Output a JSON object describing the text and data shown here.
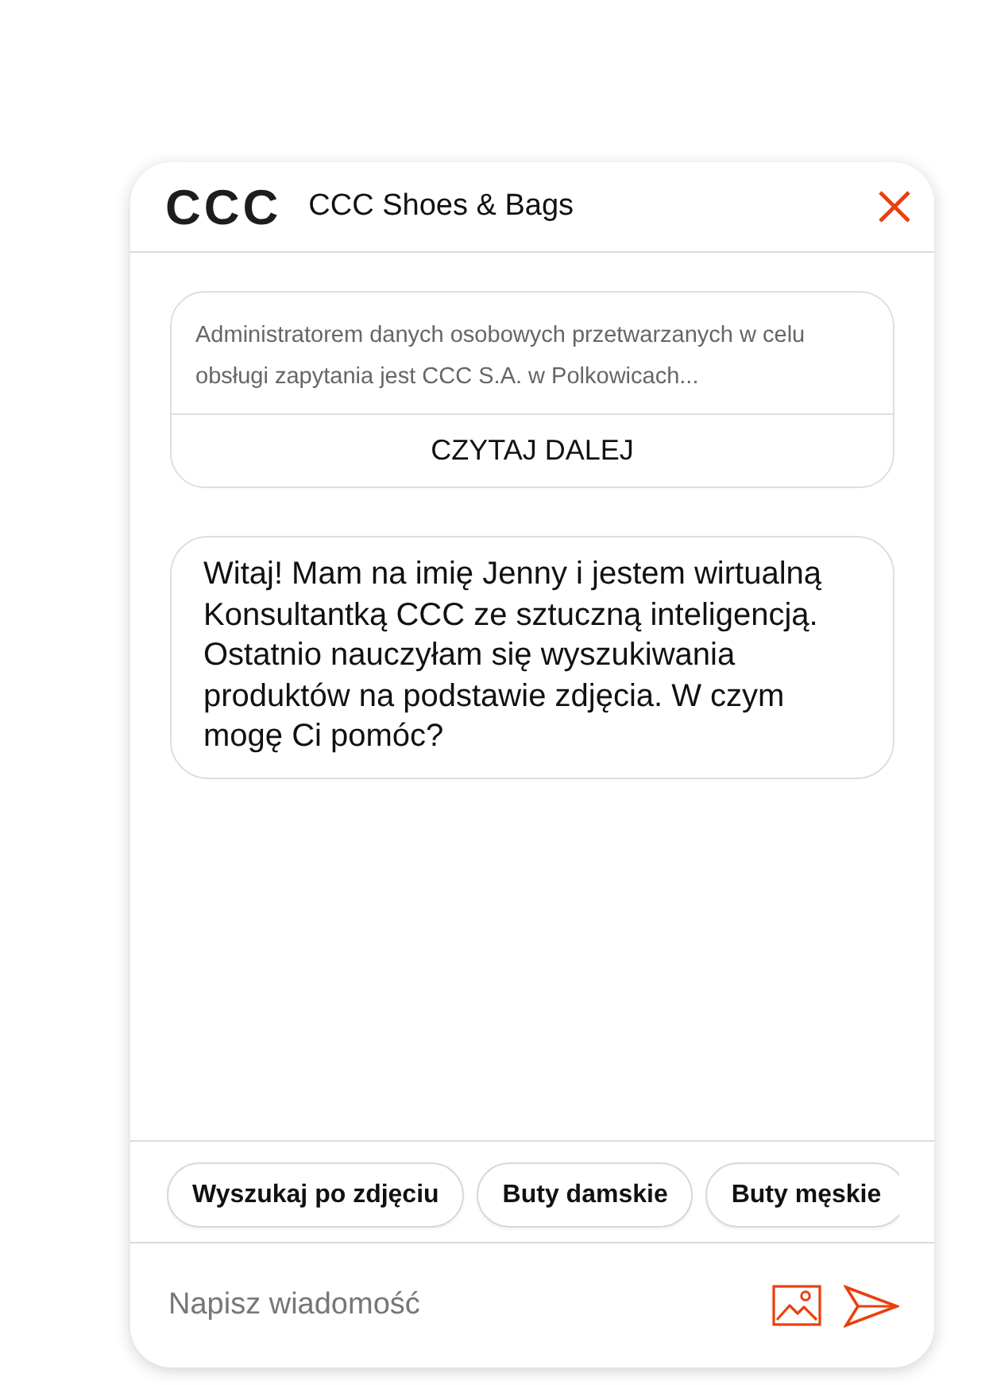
{
  "header": {
    "logo": "CCC",
    "title": "CCC Shoes & Bags"
  },
  "notice": {
    "text": "Administratorem danych osobowych przetwarzanych w celu obsługi zapytania jest CCC S.A. w Polkowicach...",
    "button": "CZYTAJ DALEJ"
  },
  "messages": [
    {
      "text": "Witaj! Mam na imię Jenny i jestem wirtualną Konsultantką CCC ze sztuczną inteligencją. Ostatnio nauczyłam się wyszukiwania produktów na podstawie zdjęcia. W czym mogę Ci pomóc?"
    }
  ],
  "quick_replies": [
    "Wyszukaj po zdjęciu",
    "Buty damskie",
    "Buty męskie"
  ],
  "composer": {
    "placeholder": "Napisz wiadomość"
  }
}
